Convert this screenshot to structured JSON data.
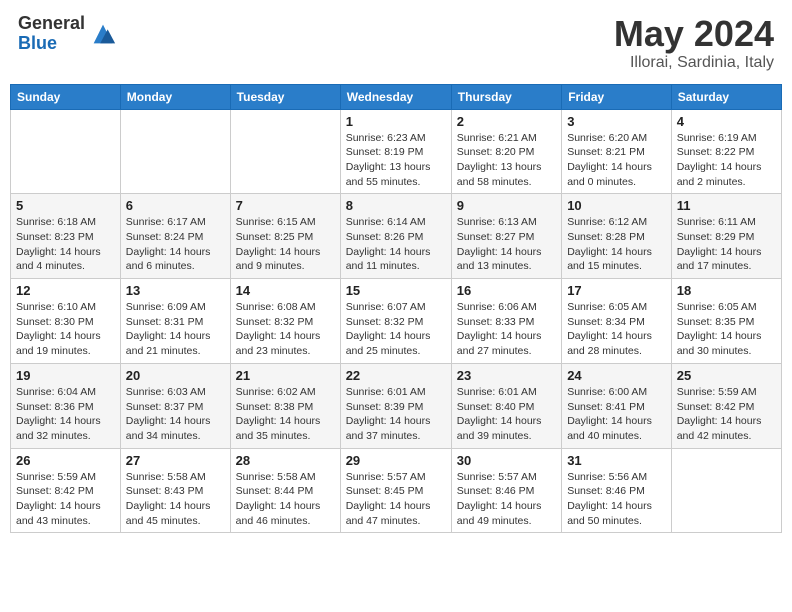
{
  "header": {
    "logo_general": "General",
    "logo_blue": "Blue",
    "month_title": "May 2024",
    "location": "Illorai, Sardinia, Italy"
  },
  "columns": [
    "Sunday",
    "Monday",
    "Tuesday",
    "Wednesday",
    "Thursday",
    "Friday",
    "Saturday"
  ],
  "weeks": [
    [
      {
        "day": "",
        "info": ""
      },
      {
        "day": "",
        "info": ""
      },
      {
        "day": "",
        "info": ""
      },
      {
        "day": "1",
        "info": "Sunrise: 6:23 AM\nSunset: 8:19 PM\nDaylight: 13 hours\nand 55 minutes."
      },
      {
        "day": "2",
        "info": "Sunrise: 6:21 AM\nSunset: 8:20 PM\nDaylight: 13 hours\nand 58 minutes."
      },
      {
        "day": "3",
        "info": "Sunrise: 6:20 AM\nSunset: 8:21 PM\nDaylight: 14 hours\nand 0 minutes."
      },
      {
        "day": "4",
        "info": "Sunrise: 6:19 AM\nSunset: 8:22 PM\nDaylight: 14 hours\nand 2 minutes."
      }
    ],
    [
      {
        "day": "5",
        "info": "Sunrise: 6:18 AM\nSunset: 8:23 PM\nDaylight: 14 hours\nand 4 minutes."
      },
      {
        "day": "6",
        "info": "Sunrise: 6:17 AM\nSunset: 8:24 PM\nDaylight: 14 hours\nand 6 minutes."
      },
      {
        "day": "7",
        "info": "Sunrise: 6:15 AM\nSunset: 8:25 PM\nDaylight: 14 hours\nand 9 minutes."
      },
      {
        "day": "8",
        "info": "Sunrise: 6:14 AM\nSunset: 8:26 PM\nDaylight: 14 hours\nand 11 minutes."
      },
      {
        "day": "9",
        "info": "Sunrise: 6:13 AM\nSunset: 8:27 PM\nDaylight: 14 hours\nand 13 minutes."
      },
      {
        "day": "10",
        "info": "Sunrise: 6:12 AM\nSunset: 8:28 PM\nDaylight: 14 hours\nand 15 minutes."
      },
      {
        "day": "11",
        "info": "Sunrise: 6:11 AM\nSunset: 8:29 PM\nDaylight: 14 hours\nand 17 minutes."
      }
    ],
    [
      {
        "day": "12",
        "info": "Sunrise: 6:10 AM\nSunset: 8:30 PM\nDaylight: 14 hours\nand 19 minutes."
      },
      {
        "day": "13",
        "info": "Sunrise: 6:09 AM\nSunset: 8:31 PM\nDaylight: 14 hours\nand 21 minutes."
      },
      {
        "day": "14",
        "info": "Sunrise: 6:08 AM\nSunset: 8:32 PM\nDaylight: 14 hours\nand 23 minutes."
      },
      {
        "day": "15",
        "info": "Sunrise: 6:07 AM\nSunset: 8:32 PM\nDaylight: 14 hours\nand 25 minutes."
      },
      {
        "day": "16",
        "info": "Sunrise: 6:06 AM\nSunset: 8:33 PM\nDaylight: 14 hours\nand 27 minutes."
      },
      {
        "day": "17",
        "info": "Sunrise: 6:05 AM\nSunset: 8:34 PM\nDaylight: 14 hours\nand 28 minutes."
      },
      {
        "day": "18",
        "info": "Sunrise: 6:05 AM\nSunset: 8:35 PM\nDaylight: 14 hours\nand 30 minutes."
      }
    ],
    [
      {
        "day": "19",
        "info": "Sunrise: 6:04 AM\nSunset: 8:36 PM\nDaylight: 14 hours\nand 32 minutes."
      },
      {
        "day": "20",
        "info": "Sunrise: 6:03 AM\nSunset: 8:37 PM\nDaylight: 14 hours\nand 34 minutes."
      },
      {
        "day": "21",
        "info": "Sunrise: 6:02 AM\nSunset: 8:38 PM\nDaylight: 14 hours\nand 35 minutes."
      },
      {
        "day": "22",
        "info": "Sunrise: 6:01 AM\nSunset: 8:39 PM\nDaylight: 14 hours\nand 37 minutes."
      },
      {
        "day": "23",
        "info": "Sunrise: 6:01 AM\nSunset: 8:40 PM\nDaylight: 14 hours\nand 39 minutes."
      },
      {
        "day": "24",
        "info": "Sunrise: 6:00 AM\nSunset: 8:41 PM\nDaylight: 14 hours\nand 40 minutes."
      },
      {
        "day": "25",
        "info": "Sunrise: 5:59 AM\nSunset: 8:42 PM\nDaylight: 14 hours\nand 42 minutes."
      }
    ],
    [
      {
        "day": "26",
        "info": "Sunrise: 5:59 AM\nSunset: 8:42 PM\nDaylight: 14 hours\nand 43 minutes."
      },
      {
        "day": "27",
        "info": "Sunrise: 5:58 AM\nSunset: 8:43 PM\nDaylight: 14 hours\nand 45 minutes."
      },
      {
        "day": "28",
        "info": "Sunrise: 5:58 AM\nSunset: 8:44 PM\nDaylight: 14 hours\nand 46 minutes."
      },
      {
        "day": "29",
        "info": "Sunrise: 5:57 AM\nSunset: 8:45 PM\nDaylight: 14 hours\nand 47 minutes."
      },
      {
        "day": "30",
        "info": "Sunrise: 5:57 AM\nSunset: 8:46 PM\nDaylight: 14 hours\nand 49 minutes."
      },
      {
        "day": "31",
        "info": "Sunrise: 5:56 AM\nSunset: 8:46 PM\nDaylight: 14 hours\nand 50 minutes."
      },
      {
        "day": "",
        "info": ""
      }
    ]
  ]
}
